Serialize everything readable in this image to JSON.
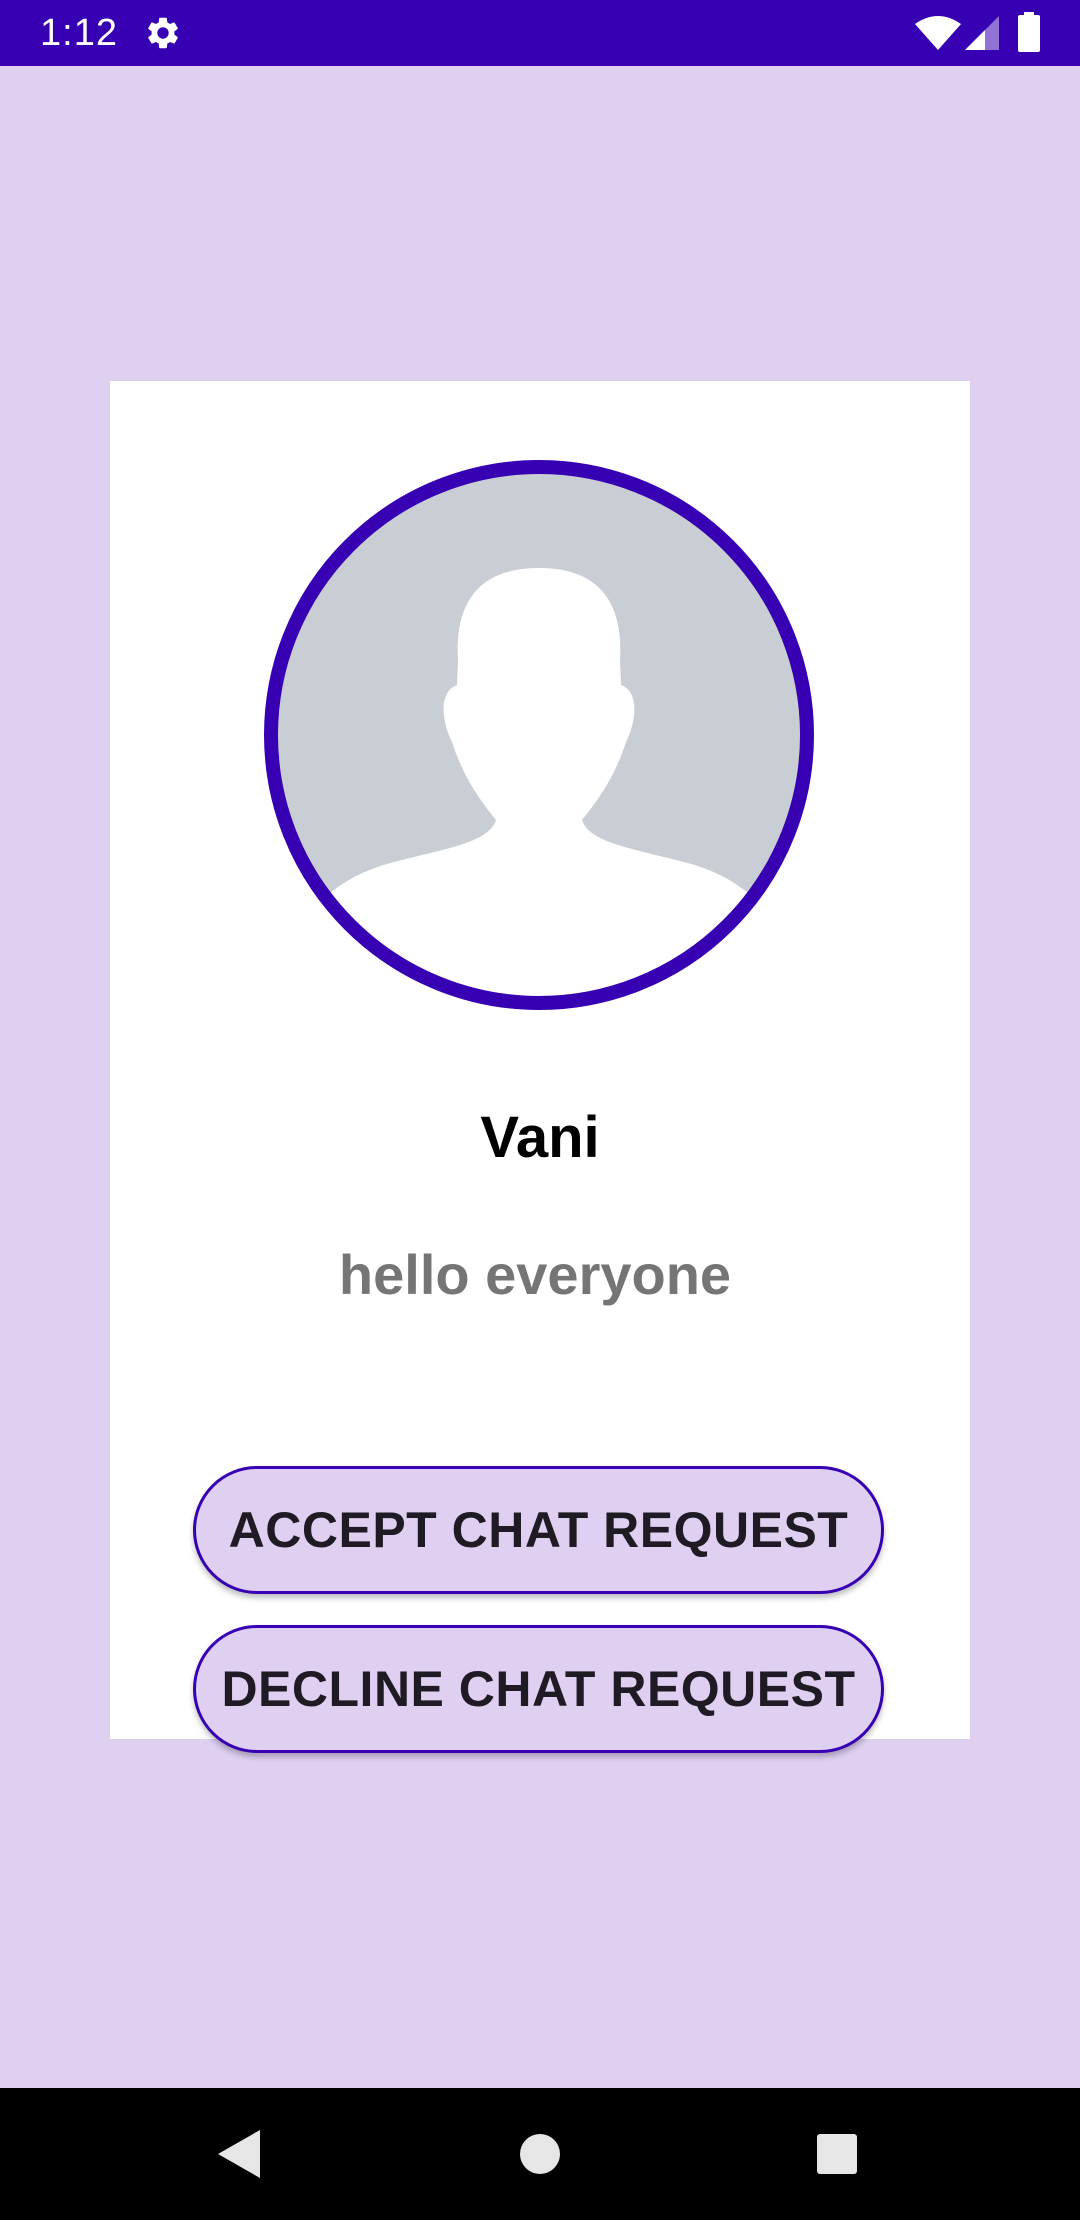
{
  "status_bar": {
    "time": "1:12",
    "icons": [
      "gear-icon",
      "wifi-icon",
      "cell-signal-icon",
      "battery-icon"
    ]
  },
  "profile": {
    "name": "Vani",
    "status": "hello everyone",
    "avatar_icon": "default-person-avatar"
  },
  "actions": {
    "accept_label": "ACCEPT CHAT REQUEST",
    "decline_label": "DECLINE CHAT REQUEST"
  },
  "navigation": {
    "icons": [
      "back-icon",
      "home-icon",
      "recents-icon"
    ]
  },
  "colors": {
    "status_bar": "#3700B3",
    "background": "#DFD0F2",
    "card": "#FFFFFF",
    "avatar_border": "#3700B3",
    "avatar_fill": "#C9CED5",
    "name_text": "#000000",
    "status_text": "#757575",
    "button_fill": "#DFD0F2",
    "button_border": "#3700B3",
    "button_text": "#1F1B24"
  }
}
